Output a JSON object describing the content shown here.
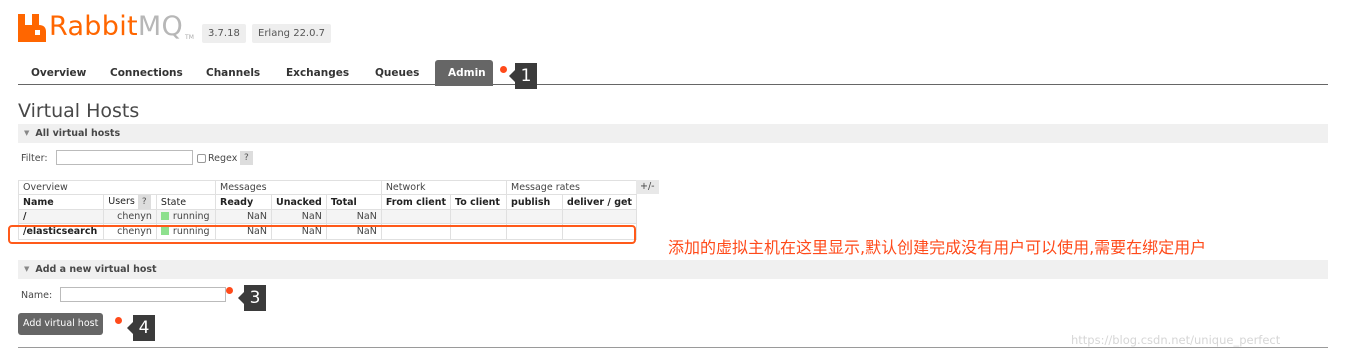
{
  "header": {
    "logo_text_main": "Rabbit",
    "logo_text_mq": "MQ",
    "logo_tm": "TM",
    "version": "3.7.18",
    "erlang": "Erlang 22.0.7"
  },
  "tabs": [
    {
      "label": "Overview"
    },
    {
      "label": "Connections"
    },
    {
      "label": "Channels"
    },
    {
      "label": "Exchanges"
    },
    {
      "label": "Queues"
    },
    {
      "label": "Admin",
      "active": true
    }
  ],
  "page_title": "Virtual Hosts",
  "all_hosts": {
    "section_label": "All virtual hosts",
    "filter_label": "Filter:",
    "filter_value": "",
    "regex_label": "Regex",
    "regex_help": "?",
    "columns_toggle": "+/-",
    "groups": {
      "overview": "Overview",
      "messages": "Messages",
      "network": "Network",
      "message_rates": "Message rates"
    },
    "headers": {
      "name": "Name",
      "users": "Users",
      "users_help": "?",
      "state": "State",
      "ready": "Ready",
      "unacked": "Unacked",
      "total": "Total",
      "from_client": "From client",
      "to_client": "To client",
      "publish": "publish",
      "deliver_get": "deliver / get"
    },
    "rows": [
      {
        "name": "/",
        "users": "chenyn",
        "state": "running",
        "ready": "NaN",
        "unacked": "NaN",
        "total": "NaN"
      },
      {
        "name": "/elasticsearch",
        "users": "chenyn",
        "state": "running",
        "ready": "NaN",
        "unacked": "NaN",
        "total": "NaN"
      }
    ]
  },
  "annotation_note": "添加的虚拟主机在这里显示,默认创建完成没有用户可以使用,需要在绑定用户",
  "add_host": {
    "section_label": "Add a new virtual host",
    "name_label": "Name:",
    "name_value": "",
    "button_label": "Add virtual host"
  },
  "callouts": [
    "1",
    "3",
    "4"
  ],
  "watermark": "https://blog.csdn.net/unique_perfect",
  "colors": {
    "brand": "#ff6600",
    "annotation": "#ff4a1a",
    "active_tab": "#666666",
    "running": "#8ee08e"
  }
}
